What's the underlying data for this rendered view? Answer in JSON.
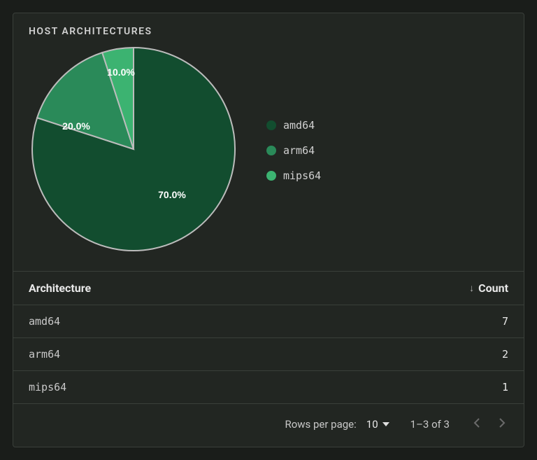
{
  "title": "HOST ARCHITECTURES",
  "chart_data": {
    "type": "pie",
    "title": "HOST ARCHITECTURES",
    "series": [
      {
        "name": "amd64",
        "value": 70.0,
        "label": "70.0%",
        "color": "#124d2f"
      },
      {
        "name": "arm64",
        "value": 20.0,
        "label": "20.0%",
        "color": "#2a8a59"
      },
      {
        "name": "mips64",
        "value": 10.0,
        "label": "10.0%",
        "color": "#3cb371"
      }
    ]
  },
  "legend": [
    {
      "label": "amd64",
      "color": "#124d2f"
    },
    {
      "label": "arm64",
      "color": "#2a8a59"
    },
    {
      "label": "mips64",
      "color": "#3cb371"
    }
  ],
  "table": {
    "headers": {
      "architecture": "Architecture",
      "count": "Count"
    },
    "sort_direction": "desc",
    "rows": [
      {
        "architecture": "amd64",
        "count": "7"
      },
      {
        "architecture": "arm64",
        "count": "2"
      },
      {
        "architecture": "mips64",
        "count": "1"
      }
    ]
  },
  "pagination": {
    "rows_per_page_label": "Rows per page:",
    "rows_per_page_value": "10",
    "range_text": "1–3 of 3"
  }
}
